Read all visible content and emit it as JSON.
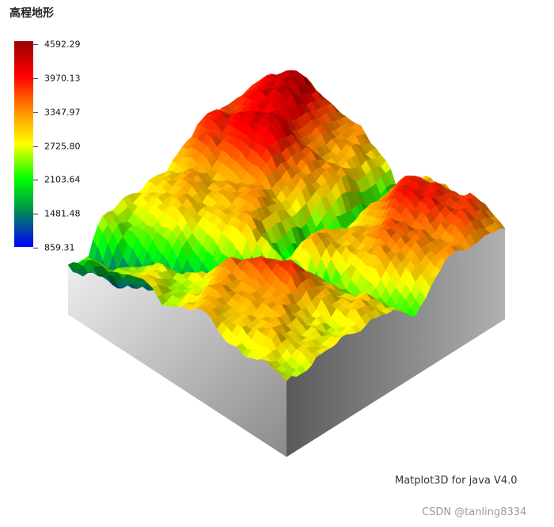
{
  "title": "高程地形",
  "chart_data": {
    "type": "surface3d",
    "colorbar": {
      "ticks": [
        4592.29,
        3970.13,
        3347.97,
        2725.8,
        2103.64,
        1481.48,
        859.31
      ],
      "tick_labels": [
        "4592.29",
        "3970.13",
        "3347.97",
        "2725.80",
        "2103.64",
        "1481.48",
        "859.31"
      ],
      "range": [
        859.31,
        4592.29
      ],
      "colormap": [
        "#0000ff",
        "#00ff00",
        "#ffff00",
        "#ff0000",
        "#990000"
      ]
    },
    "zlim": [
      859.31,
      4592.29
    ],
    "base_color": "#8c8c8c"
  },
  "footer": "Matplot3D for java V4.0",
  "watermark": "CSDN @tanling8334"
}
